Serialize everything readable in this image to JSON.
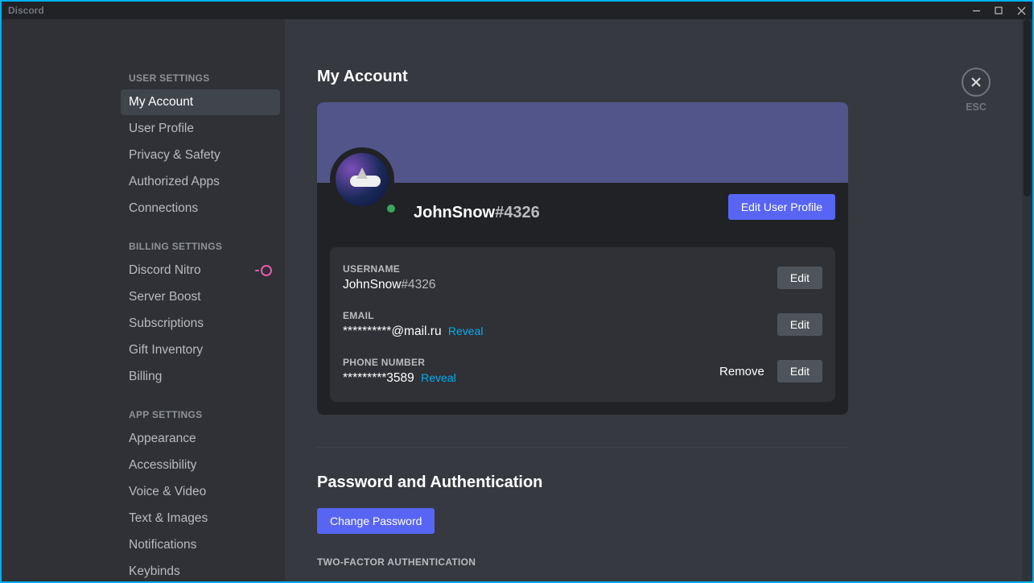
{
  "titlebar": {
    "app_name": "Discord"
  },
  "close": {
    "esc_label": "ESC"
  },
  "sidebar": {
    "headers": {
      "user": "USER SETTINGS",
      "billing": "BILLING SETTINGS",
      "app": "APP SETTINGS"
    },
    "user_items": [
      "My Account",
      "User Profile",
      "Privacy & Safety",
      "Authorized Apps",
      "Connections"
    ],
    "billing_items": [
      "Discord Nitro",
      "Server Boost",
      "Subscriptions",
      "Gift Inventory",
      "Billing"
    ],
    "app_items_visible": [
      "Appearance",
      "Accessibility",
      "Voice & Video",
      "Text & Images",
      "Notifications",
      "Keybinds"
    ]
  },
  "page": {
    "title": "My Account",
    "username": "JohnSnow",
    "discriminator": "#4326",
    "edit_profile_btn": "Edit User Profile",
    "fields": {
      "username": {
        "label": "USERNAME",
        "value": "JohnSnow",
        "suffix": "#4326",
        "edit": "Edit"
      },
      "email": {
        "label": "EMAIL",
        "value": "**********@mail.ru",
        "reveal": "Reveal",
        "edit": "Edit"
      },
      "phone": {
        "label": "PHONE NUMBER",
        "value": "*********3589",
        "reveal": "Reveal",
        "remove": "Remove",
        "edit": "Edit"
      }
    },
    "pw_section": "Password and Authentication",
    "change_pw_btn": "Change Password",
    "tfa_header": "TWO-FACTOR AUTHENTICATION"
  }
}
